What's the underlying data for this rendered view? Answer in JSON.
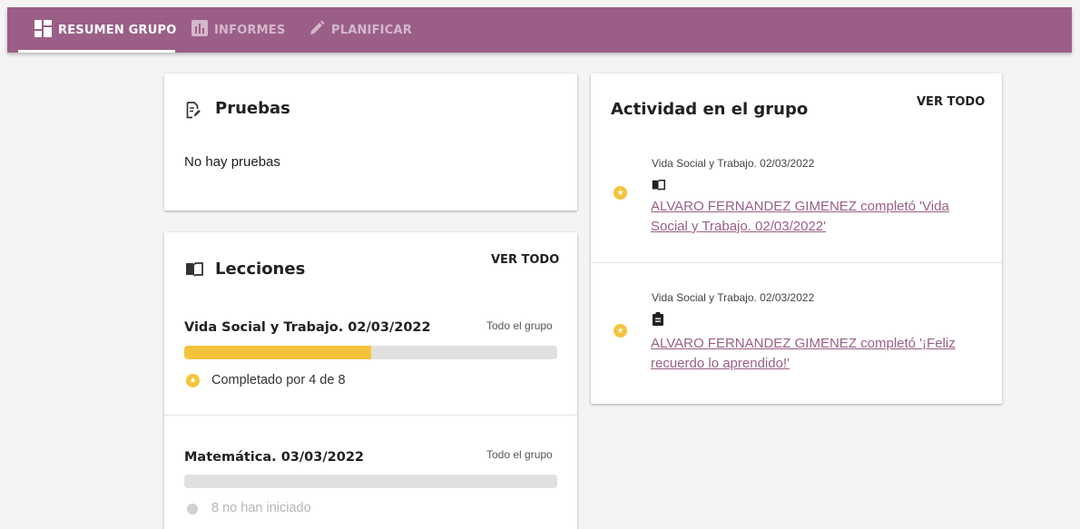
{
  "nav": {
    "tabs": [
      {
        "label": "RESUMEN GRUPO",
        "icon": "dashboard-icon",
        "active": true
      },
      {
        "label": "INFORMES",
        "icon": "bar-chart-icon",
        "active": false
      },
      {
        "label": "PLANIFICAR",
        "icon": "pencil-icon",
        "active": false
      }
    ]
  },
  "colors": {
    "accent": "#9b5f87",
    "progress": "#f5c33b",
    "track": "#e0e0e0",
    "background": "#f4f4f4"
  },
  "tests": {
    "title": "Pruebas",
    "icon": "edit-document-icon",
    "empty_text": "No hay pruebas"
  },
  "lessons": {
    "title": "Lecciones",
    "icon": "book-icon",
    "view_all": "VER TODO",
    "items": [
      {
        "title": "Vida Social y Trabajo. 02/03/2022",
        "scope": "Todo el grupo",
        "progress": 0.5,
        "status_icon": "star-icon",
        "status": "Completado por 4 de 8"
      },
      {
        "title": "Matemática. 03/03/2022",
        "scope": "Todo el grupo",
        "progress": 0,
        "status_icon": "grey-dot-icon",
        "status": "8 no han iniciado"
      }
    ]
  },
  "activity": {
    "title": "Actividad en el grupo",
    "view_all": "VER TODO",
    "items": [
      {
        "meta": "Vida Social y Trabajo. 02/03/2022",
        "type_icon": "book-icon",
        "badge_icon": "star-icon",
        "text": "ALVARO FERNANDEZ GIMENEZ completó 'Vida Social y Trabajo. 02/03/2022'"
      },
      {
        "meta": "Vida Social y Trabajo. 02/03/2022",
        "type_icon": "clipboard-icon",
        "badge_icon": "star-icon",
        "text": "ALVARO FERNANDEZ GIMENEZ completó '¡Feliz recuerdo lo aprendido!'"
      }
    ]
  }
}
